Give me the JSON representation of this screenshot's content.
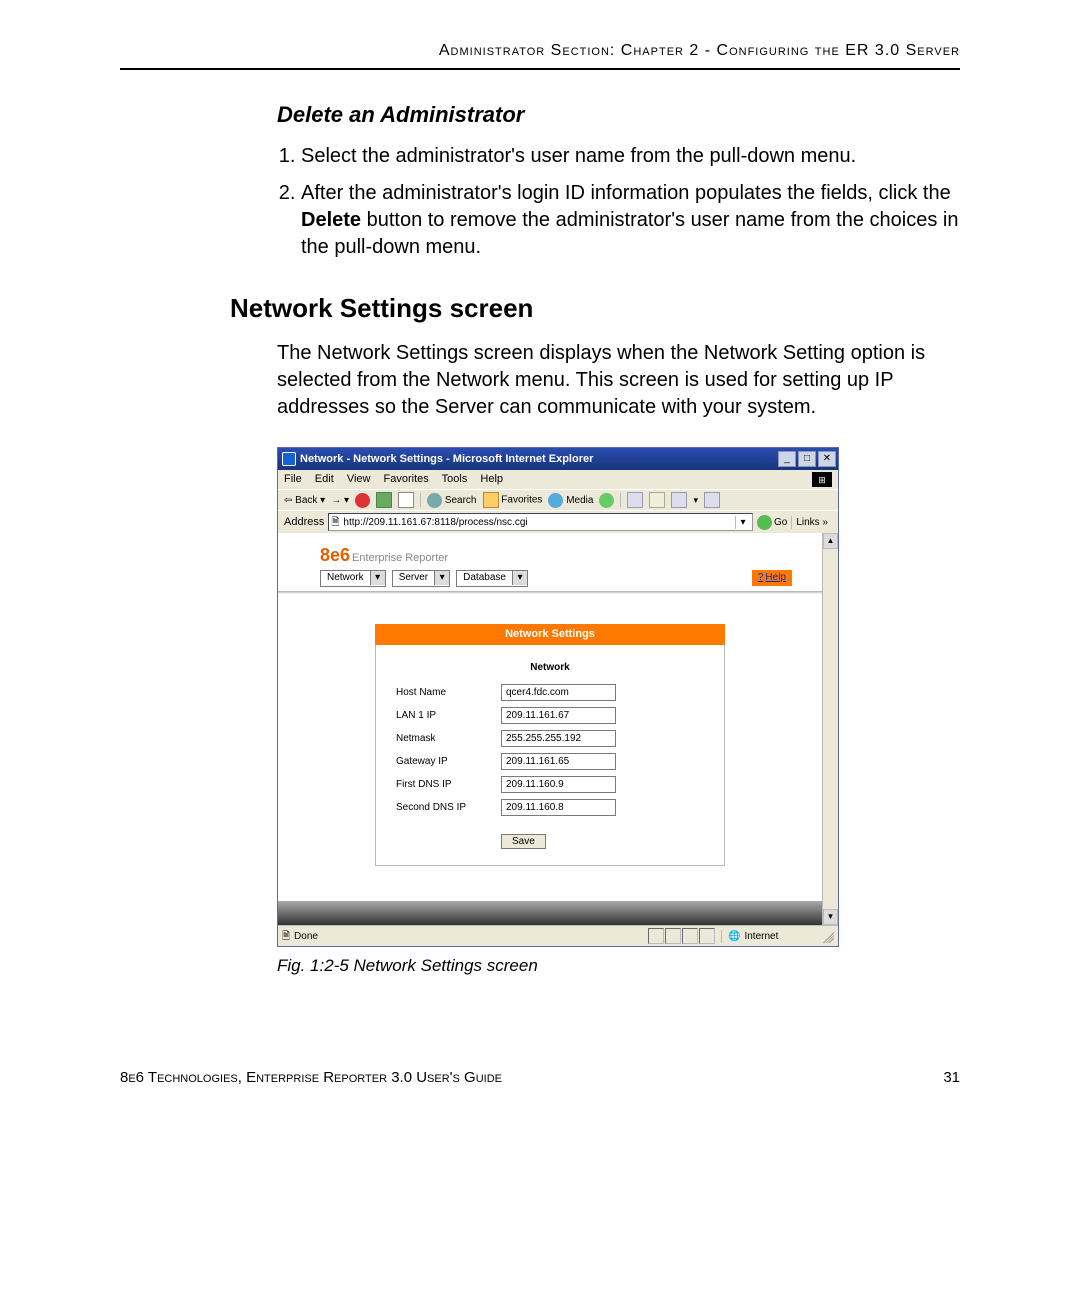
{
  "running_head": "Administrator Section: Chapter 2 - Configuring the ER 3.0 Server",
  "section": {
    "delete_admin_heading": "Delete an Administrator",
    "step1": "Select the administrator's user name from the pull-down menu.",
    "step2_a": "After the administrator's login ID information populates the fields, click the ",
    "step2_bold": "Delete",
    "step2_b": " button to remove the administrator's user name from the choices in the pull-down menu."
  },
  "network_heading": "Network Settings screen",
  "network_intro": "The Network Settings screen displays when the Network Setting option is selected from the Network menu. This screen is used for setting up IP addresses so the Server can communicate with your system.",
  "ie": {
    "title": "Network - Network Settings - Microsoft Internet Explorer",
    "menus": [
      "File",
      "Edit",
      "View",
      "Favorites",
      "Tools",
      "Help"
    ],
    "toolbar": {
      "back": "Back",
      "search": "Search",
      "favorites": "Favorites",
      "media": "Media"
    },
    "address_label": "Address",
    "address_url": "http://209.11.161.67:8118/process/nsc.cgi",
    "go": "Go",
    "links": "Links »",
    "logo_main": "8e6",
    "logo_sub": "Enterprise Reporter",
    "top_selects": [
      "Network",
      "Server",
      "Database"
    ],
    "help": "Help",
    "panel_title": "Network Settings",
    "panel_subtitle": "Network",
    "fields": [
      {
        "label": "Host Name",
        "value": "qcer4.fdc.com"
      },
      {
        "label": "LAN 1 IP",
        "value": "209.11.161.67"
      },
      {
        "label": "Netmask",
        "value": "255.255.255.192"
      },
      {
        "label": "Gateway IP",
        "value": "209.11.161.65"
      },
      {
        "label": "First DNS IP",
        "value": "209.11.160.9"
      },
      {
        "label": "Second DNS IP",
        "value": "209.11.160.8"
      }
    ],
    "save": "Save",
    "status_done": "Done",
    "status_zone": "Internet"
  },
  "figure_caption": "Fig. 1:2-5  Network Settings screen",
  "footer_text": "8e6 Technologies, Enterprise Reporter 3.0 User's Guide",
  "page_number": "31"
}
